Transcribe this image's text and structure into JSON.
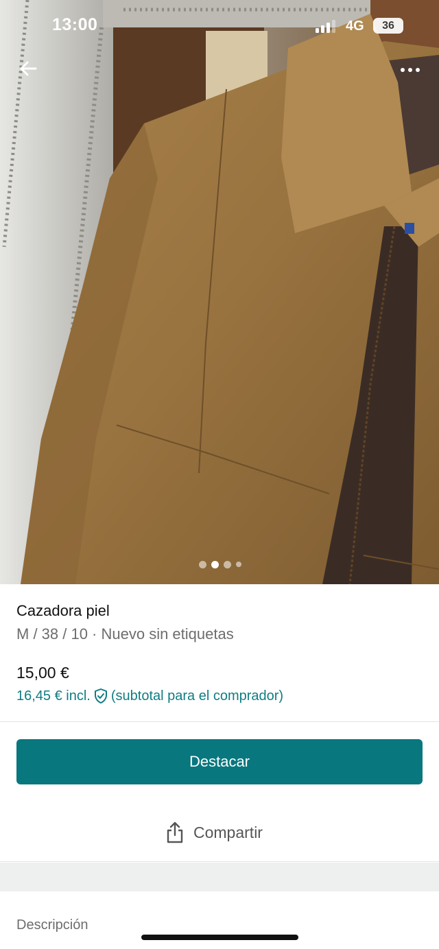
{
  "status_bar": {
    "time": "13:00",
    "network": "4G",
    "battery": "36"
  },
  "photo": {
    "alt": "Cazadora piel",
    "page_count": 4,
    "active_page": 2
  },
  "product": {
    "title": "Cazadora piel",
    "subtitle": "M / 38 / 10 · Nuevo sin etiquetas",
    "price": "15,00 €",
    "price_incl": "16,45 € incl.",
    "price_note": "(subtotal para el comprador)"
  },
  "actions": {
    "primary_label": "Destacar",
    "share_label": "Compartir"
  },
  "sections": {
    "description_label": "Descripción"
  },
  "icons": {
    "back": "arrow-left-icon",
    "more": "more-horizontal-icon",
    "protection": "shield-check-icon",
    "share": "share-icon"
  },
  "colors": {
    "accent": "#09777e",
    "accent_text": "#0f7c82",
    "secondary_text": "#6d6d6d",
    "band": "#eef0f0"
  }
}
